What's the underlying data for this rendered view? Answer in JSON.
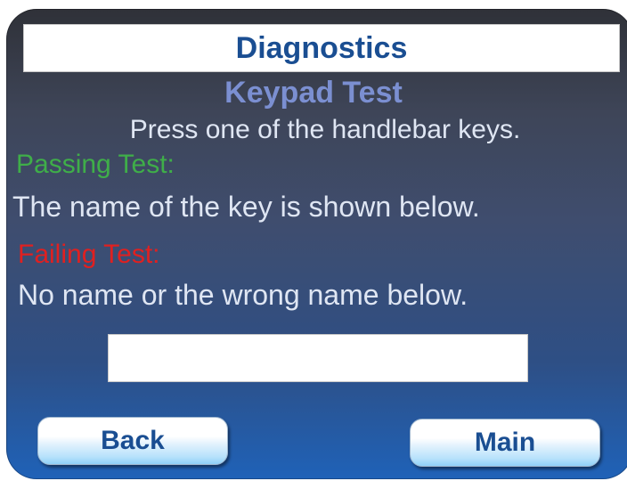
{
  "header": {
    "title": "Diagnostics"
  },
  "test": {
    "name": "Keypad Test",
    "instruction": "Press one of the handlebar keys."
  },
  "passing": {
    "label": "Passing Test:",
    "description": "The name of the key is shown below."
  },
  "failing": {
    "label": "Failing Test:",
    "description": "No name or the wrong name below."
  },
  "key_display": {
    "value": ""
  },
  "buttons": {
    "back": "Back",
    "main": "Main"
  },
  "colors": {
    "title": "#1a4e92",
    "subtitle": "#7b8fd1",
    "pass": "#3fae49",
    "fail": "#e02020",
    "text": "#dfe6f3"
  }
}
